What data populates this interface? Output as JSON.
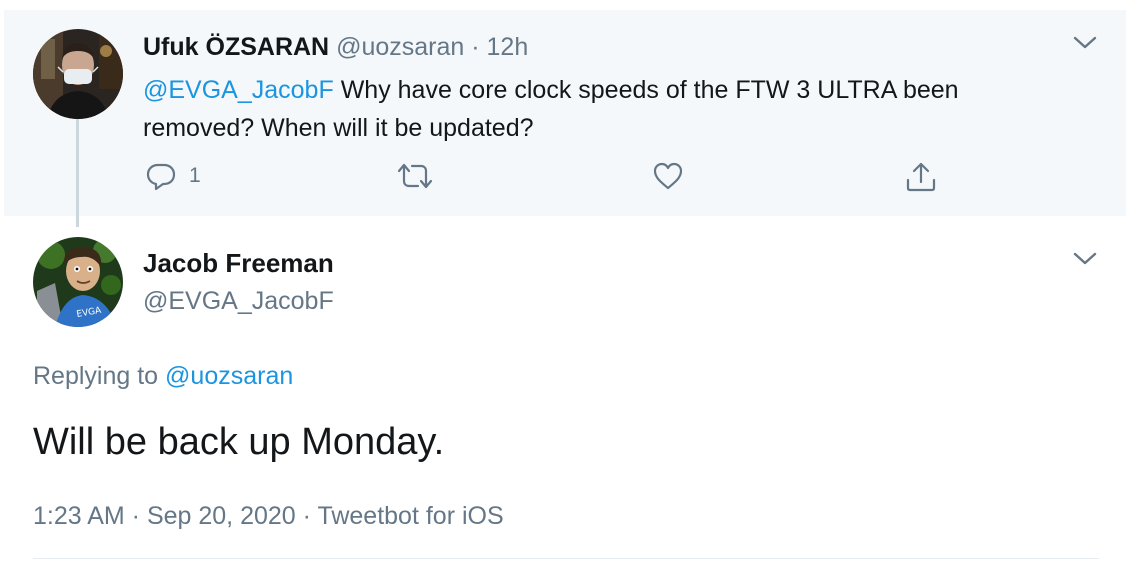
{
  "parent_tweet": {
    "display_name": "Ufuk ÖZSARAN",
    "handle": "@uozsaran",
    "separator": "·",
    "time": "12h",
    "mention": "@EVGA_JacobF",
    "text": " Why have core clock speeds of the FTW 3 ULTRA been removed? When will it be updated?",
    "reply_count": "1",
    "avatar_icon": "user-photo-avatar",
    "action_icons": [
      "reply-icon",
      "retweet-icon",
      "like-icon",
      "share-icon"
    ]
  },
  "main_tweet": {
    "display_name": "Jacob Freeman",
    "handle": "@EVGA_JacobF",
    "replying_prefix": "Replying to ",
    "replying_handle": "@uozsaran",
    "text": "Will be back up Monday.",
    "timestamp": "1:23 AM · Sep 20, 2020 · Tweetbot for iOS",
    "avatar_icon": "cartoon-avatar"
  },
  "colors": {
    "link": "#1b95e0",
    "text": "#14171a",
    "secondary": "#657786",
    "parent_background": "#f5f8fa",
    "thread_line": "#ccd6dd"
  }
}
